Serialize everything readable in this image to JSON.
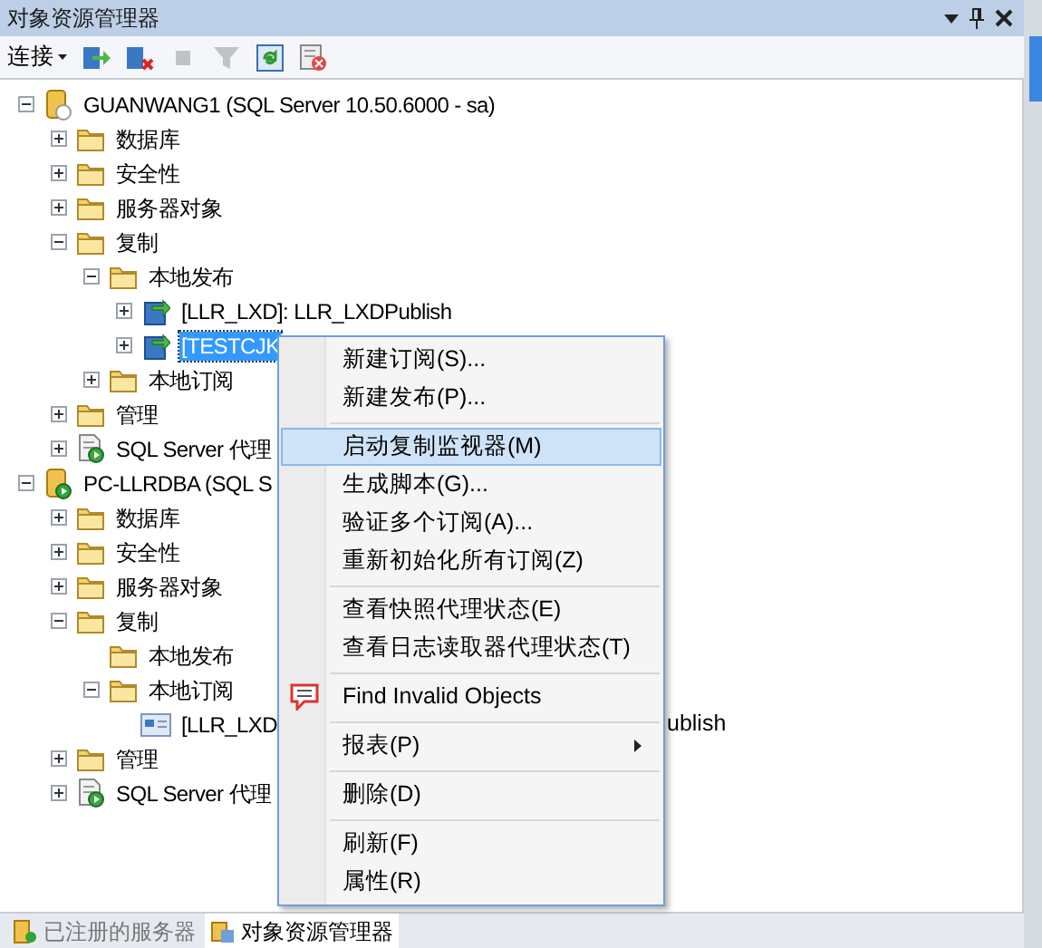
{
  "window": {
    "title": "对象资源管理器"
  },
  "toolbar": {
    "connect_label": "连接",
    "buttons": [
      {
        "kind": "connect",
        "disabled": false
      },
      {
        "kind": "disconnect",
        "disabled": false
      },
      {
        "kind": "stop",
        "disabled": true
      },
      {
        "kind": "filter",
        "disabled": true
      },
      {
        "kind": "refresh",
        "disabled": false
      },
      {
        "kind": "activity",
        "disabled": false
      }
    ]
  },
  "tree": [
    {
      "text": "GUANWANG1 (SQL Server 10.50.6000 - sa)",
      "kind": "server",
      "expanded": true,
      "selected": false,
      "children": [
        {
          "text": "数据库",
          "kind": "folder",
          "expanded": false,
          "selected": false
        },
        {
          "text": "安全性",
          "kind": "folder",
          "expanded": false,
          "selected": false
        },
        {
          "text": "服务器对象",
          "kind": "folder",
          "expanded": false,
          "selected": false
        },
        {
          "text": "复制",
          "kind": "folder",
          "expanded": true,
          "selected": false,
          "children": [
            {
              "text": "本地发布",
              "kind": "folder",
              "expanded": true,
              "selected": false,
              "children": [
                {
                  "text": "[LLR_LXD]: LLR_LXDPublish",
                  "kind": "publication",
                  "expanded": false,
                  "selected": false
                },
                {
                  "text": "[TESTCJK",
                  "kind": "publication",
                  "expanded": false,
                  "selected": true
                }
              ]
            },
            {
              "text": "本地订阅",
              "kind": "folder",
              "expanded": false,
              "selected": false
            }
          ]
        },
        {
          "text": "管理",
          "kind": "folder",
          "expanded": false,
          "selected": false
        },
        {
          "text": "SQL Server 代理",
          "kind": "agent",
          "expanded": false,
          "selected": false
        }
      ]
    },
    {
      "text": "PC-LLRDBA (SQL S",
      "kind": "server-running",
      "expanded": true,
      "selected": false,
      "children": [
        {
          "text": "数据库",
          "kind": "folder",
          "expanded": false,
          "selected": false
        },
        {
          "text": "安全性",
          "kind": "folder",
          "expanded": false,
          "selected": false
        },
        {
          "text": "服务器对象",
          "kind": "folder",
          "expanded": false,
          "selected": false
        },
        {
          "text": "复制",
          "kind": "folder",
          "expanded": true,
          "selected": false,
          "children": [
            {
              "text": "本地发布",
              "kind": "folder",
              "selected": false
            },
            {
              "text": "本地订阅",
              "kind": "folder",
              "expanded": true,
              "selected": false,
              "children": [
                {
                  "text": "[LLR_LXD",
                  "tail": "ublish",
                  "kind": "subscription",
                  "selected": false
                }
              ]
            }
          ]
        },
        {
          "text": "管理",
          "kind": "folder",
          "expanded": false,
          "selected": false
        },
        {
          "text": "SQL Server 代理",
          "kind": "agent",
          "expanded": false,
          "selected": false
        }
      ]
    }
  ],
  "context_menu": [
    {
      "kind": "item",
      "text": "新建订阅(S)...",
      "selected": false
    },
    {
      "kind": "item",
      "text": "新建发布(P)...",
      "selected": false
    },
    {
      "kind": "separator"
    },
    {
      "kind": "item",
      "text": "启动复制监视器(M)",
      "selected": true
    },
    {
      "kind": "item",
      "text": "生成脚本(G)...",
      "selected": false
    },
    {
      "kind": "item",
      "text": "验证多个订阅(A)...",
      "selected": false
    },
    {
      "kind": "item",
      "text": "重新初始化所有订阅(Z)",
      "selected": false
    },
    {
      "kind": "separator"
    },
    {
      "kind": "item",
      "text": "查看快照代理状态(E)",
      "selected": false
    },
    {
      "kind": "item",
      "text": "查看日志读取器代理状态(T)",
      "selected": false
    },
    {
      "kind": "separator"
    },
    {
      "kind": "icon-item",
      "text": "Find Invalid Objects",
      "selected": false
    },
    {
      "kind": "separator"
    },
    {
      "kind": "submenu",
      "text": "报表(P)",
      "selected": false
    },
    {
      "kind": "separator"
    },
    {
      "kind": "item",
      "text": "删除(D)",
      "selected": false
    },
    {
      "kind": "separator"
    },
    {
      "kind": "item",
      "text": "刷新(F)",
      "selected": false
    },
    {
      "kind": "item",
      "text": "属性(R)",
      "selected": false
    }
  ],
  "bottom_tabs": [
    {
      "label": "已注册的服务器",
      "selected": false
    },
    {
      "label": "对象资源管理器",
      "selected": true
    }
  ]
}
